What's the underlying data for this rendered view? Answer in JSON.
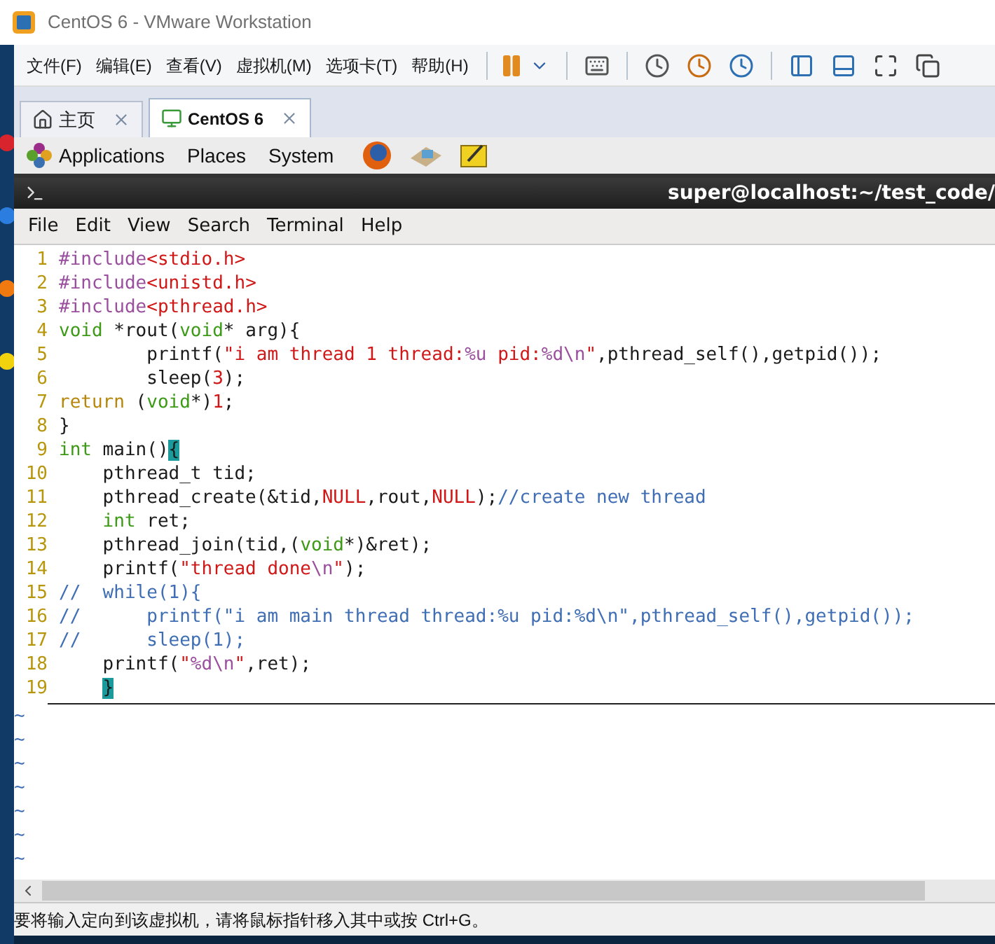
{
  "window": {
    "title": "CentOS 6 - VMware Workstation"
  },
  "menu": [
    "文件(F)",
    "编辑(E)",
    "查看(V)",
    "虚拟机(M)",
    "选项卡(T)",
    "帮助(H)"
  ],
  "tabs": [
    {
      "label": "主页",
      "selected": false,
      "kind": "home"
    },
    {
      "label": "CentOS 6",
      "selected": true,
      "kind": "vm"
    }
  ],
  "panel": {
    "items": [
      "Applications",
      "Places",
      "System"
    ]
  },
  "terminal": {
    "title": "super@localhost:~/test_code/",
    "menu": [
      "File",
      "Edit",
      "View",
      "Search",
      "Terminal",
      "Help"
    ]
  },
  "editor": {
    "lines": [
      {
        "number": "1",
        "tokens": [
          {
            "kind": "preproc",
            "text": "#include"
          },
          {
            "kind": "string",
            "text": "<stdio.h>"
          }
        ]
      },
      {
        "number": "2",
        "tokens": [
          {
            "kind": "preproc",
            "text": "#include"
          },
          {
            "kind": "string",
            "text": "<unistd.h>"
          }
        ]
      },
      {
        "number": "3",
        "tokens": [
          {
            "kind": "preproc",
            "text": "#include"
          },
          {
            "kind": "string",
            "text": "<pthread.h>"
          }
        ]
      },
      {
        "number": "4",
        "tokens": [
          {
            "kind": "type",
            "text": "void"
          },
          {
            "kind": "plain",
            "text": " *rout("
          },
          {
            "kind": "type",
            "text": "void"
          },
          {
            "kind": "plain",
            "text": "* arg){"
          }
        ]
      },
      {
        "number": "5",
        "tokens": [
          {
            "kind": "plain",
            "text": "        printf("
          },
          {
            "kind": "string",
            "text": "\"i am thread 1 thread:"
          },
          {
            "kind": "special",
            "text": "%u"
          },
          {
            "kind": "string",
            "text": " pid:"
          },
          {
            "kind": "special",
            "text": "%d\\n"
          },
          {
            "kind": "string",
            "text": "\""
          },
          {
            "kind": "plain",
            "text": ",pthread_self(),getpid());"
          }
        ]
      },
      {
        "number": "6",
        "tokens": [
          {
            "kind": "plain",
            "text": "        sleep("
          },
          {
            "kind": "string",
            "text": "3"
          },
          {
            "kind": "plain",
            "text": ");"
          }
        ]
      },
      {
        "number": "7",
        "tokens": [
          {
            "kind": "keyword",
            "text": "return"
          },
          {
            "kind": "plain",
            "text": " ("
          },
          {
            "kind": "type",
            "text": "void"
          },
          {
            "kind": "plain",
            "text": "*)"
          },
          {
            "kind": "string",
            "text": "1"
          },
          {
            "kind": "plain",
            "text": ";"
          }
        ]
      },
      {
        "number": "8",
        "tokens": [
          {
            "kind": "plain",
            "text": "}"
          }
        ]
      },
      {
        "number": "9",
        "tokens": [
          {
            "kind": "type",
            "text": "int"
          },
          {
            "kind": "plain",
            "text": " main()"
          },
          {
            "kind": "cursor",
            "text": "{"
          }
        ]
      },
      {
        "number": "10",
        "tokens": [
          {
            "kind": "plain",
            "text": "    pthread_t tid;"
          }
        ]
      },
      {
        "number": "11",
        "tokens": [
          {
            "kind": "plain",
            "text": "    pthread_create(&tid,"
          },
          {
            "kind": "string",
            "text": "NULL"
          },
          {
            "kind": "plain",
            "text": ",rout,"
          },
          {
            "kind": "string",
            "text": "NULL"
          },
          {
            "kind": "plain",
            "text": ");"
          },
          {
            "kind": "comment",
            "text": "//create new thread"
          }
        ]
      },
      {
        "number": "12",
        "tokens": [
          {
            "kind": "type",
            "text": "    int"
          },
          {
            "kind": "plain",
            "text": " ret;"
          }
        ]
      },
      {
        "number": "13",
        "tokens": [
          {
            "kind": "plain",
            "text": "    pthread_join(tid,("
          },
          {
            "kind": "type",
            "text": "void"
          },
          {
            "kind": "plain",
            "text": "*)&ret);"
          }
        ]
      },
      {
        "number": "14",
        "tokens": [
          {
            "kind": "plain",
            "text": "    printf("
          },
          {
            "kind": "string",
            "text": "\"thread done"
          },
          {
            "kind": "special",
            "text": "\\n"
          },
          {
            "kind": "string",
            "text": "\""
          },
          {
            "kind": "plain",
            "text": ");"
          }
        ]
      },
      {
        "number": "15",
        "tokens": [
          {
            "kind": "comment",
            "text": "//  while(1){"
          }
        ]
      },
      {
        "number": "16",
        "tokens": [
          {
            "kind": "comment",
            "text": "//      printf(\"i am main thread thread:%u pid:%d\\n\",pthread_self(),getpid());"
          }
        ]
      },
      {
        "number": "17",
        "tokens": [
          {
            "kind": "comment",
            "text": "//      sleep(1);"
          }
        ]
      },
      {
        "number": "18",
        "tokens": [
          {
            "kind": "plain",
            "text": "    printf("
          },
          {
            "kind": "string",
            "text": "\""
          },
          {
            "kind": "special",
            "text": "%d\\n"
          },
          {
            "kind": "string",
            "text": "\""
          },
          {
            "kind": "plain",
            "text": ",ret);"
          }
        ]
      },
      {
        "number": "19",
        "tokens": [
          {
            "kind": "indented_cursor",
            "text": "}"
          }
        ]
      }
    ],
    "empty_lines": [
      "~",
      "~",
      "~",
      "~",
      "~",
      "~",
      "~"
    ]
  },
  "status_bar": "要将输入定向到该虚拟机，请将鼠标指针移入其中或按 Ctrl+G。"
}
